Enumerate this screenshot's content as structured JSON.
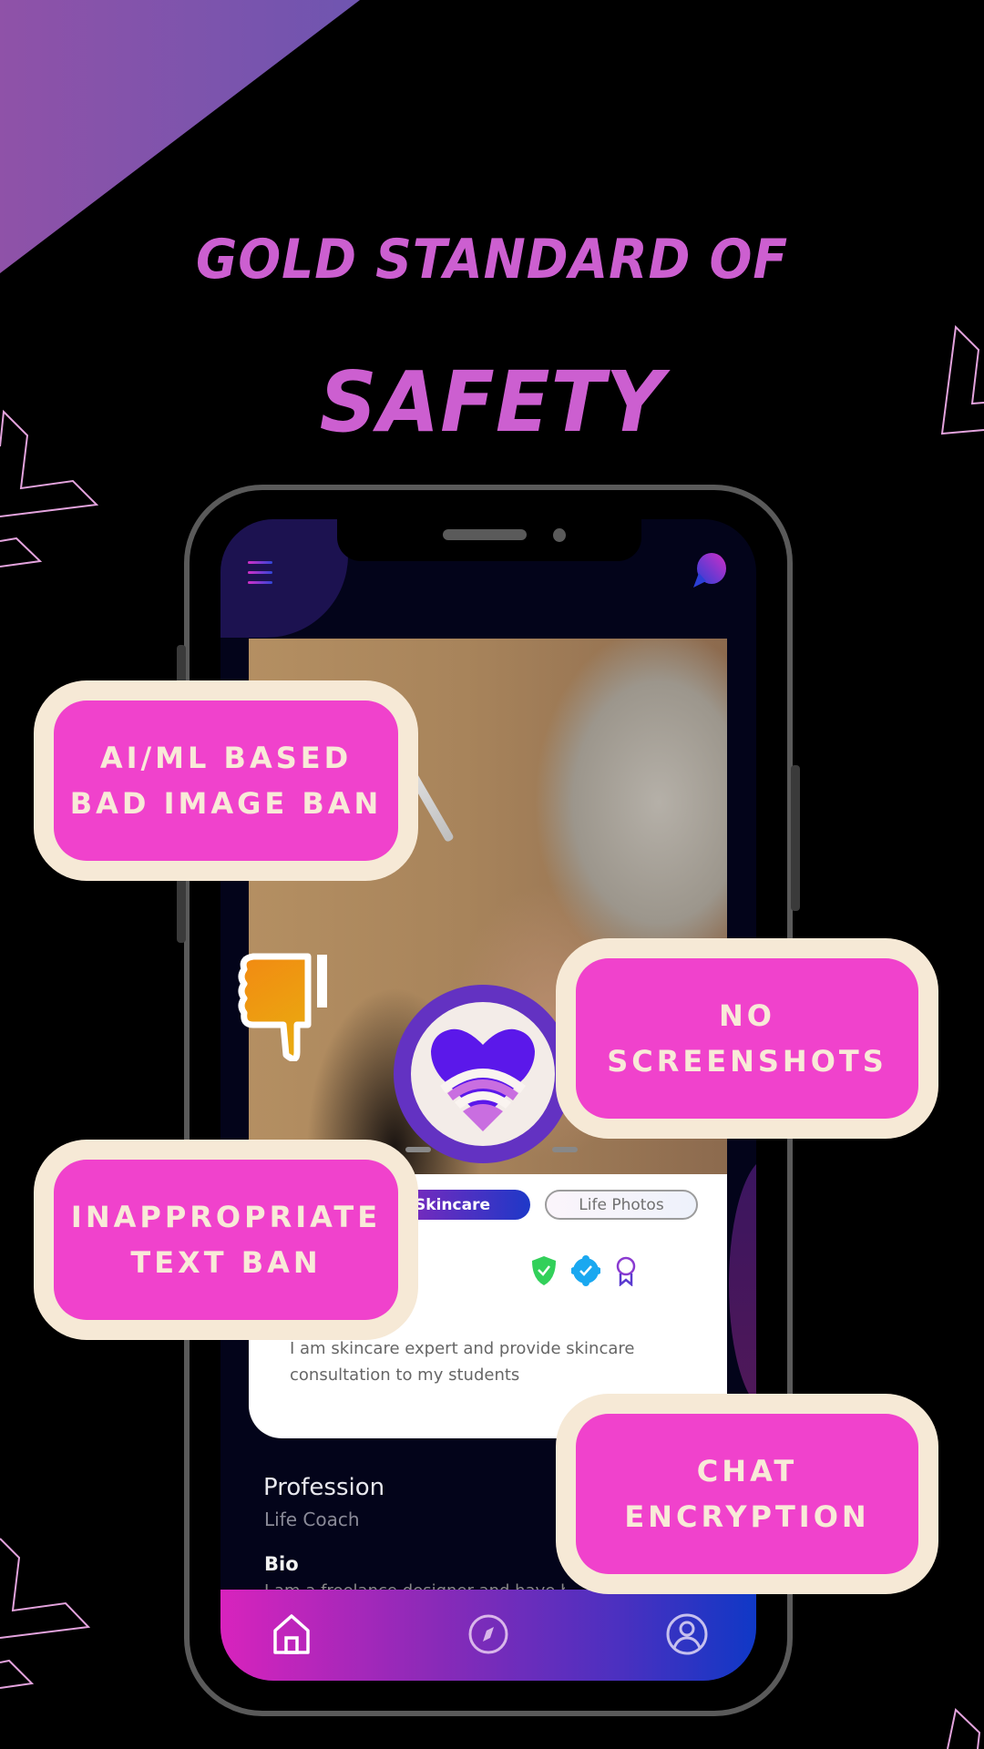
{
  "headline": {
    "line1": "GOLD STANDARD OF",
    "line2": "SAFETY"
  },
  "colors": {
    "headline": "#cc5fd0",
    "callout_fill": "#f042cc",
    "callout_border": "#f6e9d6",
    "callout_text": "#f8ead8",
    "logo_ring": "#6332c2",
    "deco_outline": "#e3a3dd"
  },
  "features": [
    {
      "label": "AI/ML BASED\nBAD IMAGE BAN"
    },
    {
      "label": "NO\nSCREENSHOTS"
    },
    {
      "label": "INAPPROPRIATE\nTEXT BAN"
    },
    {
      "label": "CHAT\nENCRYPTION"
    }
  ],
  "app": {
    "header": {
      "menu_icon": "hamburger-menu-icon",
      "chat_icon": "chat-bubble-icon"
    },
    "photo_overlay_icon": "thumbs-down-icon",
    "logo_icon": "heart-wifi-logo",
    "tags": [
      {
        "label": "Skincare",
        "active": true
      },
      {
        "label": "Life Photos",
        "active": false
      }
    ],
    "badges": [
      "shield-check-icon",
      "verified-badge-icon",
      "award-ribbon-icon"
    ],
    "card_bio": "I am skincare expert and provide skincare consultation to my students",
    "profession_label": "Profession",
    "profession_value": "Life Coach",
    "bio_label": "Bio",
    "bio_preview": "I am a freelance designer and have been",
    "bottom_nav": [
      {
        "name": "home",
        "icon": "home-icon",
        "active": true
      },
      {
        "name": "explore",
        "icon": "compass-icon",
        "active": false
      },
      {
        "name": "profile",
        "icon": "user-circle-icon",
        "active": false
      }
    ]
  }
}
